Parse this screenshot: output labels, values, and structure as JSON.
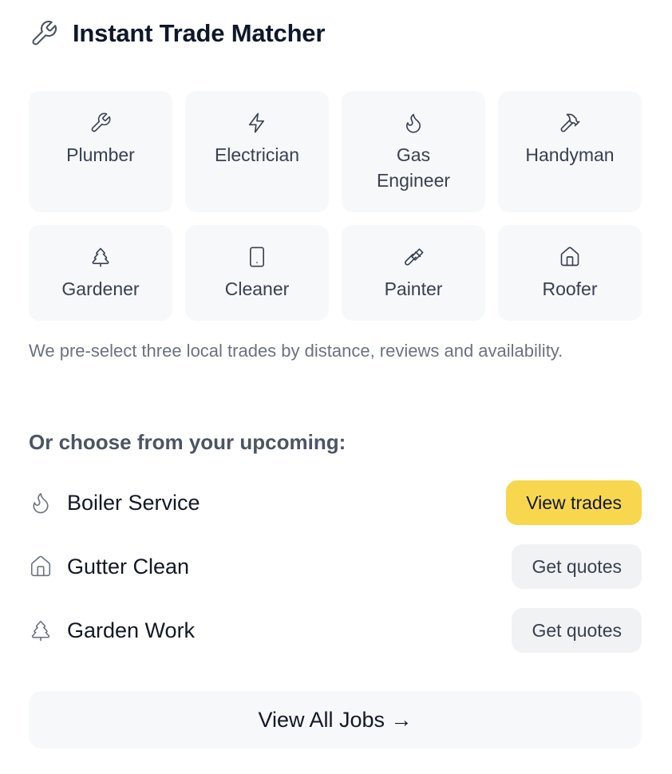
{
  "header": {
    "title": "Instant Trade Matcher",
    "icon": "wrench-icon"
  },
  "trades": [
    {
      "label": "Plumber",
      "icon": "wrench-icon"
    },
    {
      "label": "Electrician",
      "icon": "lightning-icon"
    },
    {
      "label": "Gas Engineer",
      "icon": "flame-icon"
    },
    {
      "label": "Handyman",
      "icon": "hammer-icon"
    },
    {
      "label": "Gardener",
      "icon": "tree-icon"
    },
    {
      "label": "Cleaner",
      "icon": "phone-icon"
    },
    {
      "label": "Painter",
      "icon": "paintbrush-icon"
    },
    {
      "label": "Roofer",
      "icon": "house-icon"
    }
  ],
  "note": "We pre-select three local trades by distance, reviews and availability.",
  "upcoming": {
    "heading": "Or choose from your upcoming:",
    "jobs": [
      {
        "label": "Boiler Service",
        "icon": "flame-icon",
        "button": "View trades",
        "style": "primary"
      },
      {
        "label": "Gutter Clean",
        "icon": "house-icon",
        "button": "Get quotes",
        "style": "secondary"
      },
      {
        "label": "Garden Work",
        "icon": "tree-icon",
        "button": "Get quotes",
        "style": "secondary"
      }
    ]
  },
  "footer": {
    "view_all": "View All Jobs →"
  },
  "colors": {
    "accent": "#f8d74e",
    "tile_bg": "#f7f8fa",
    "muted_text": "#6b7280"
  }
}
